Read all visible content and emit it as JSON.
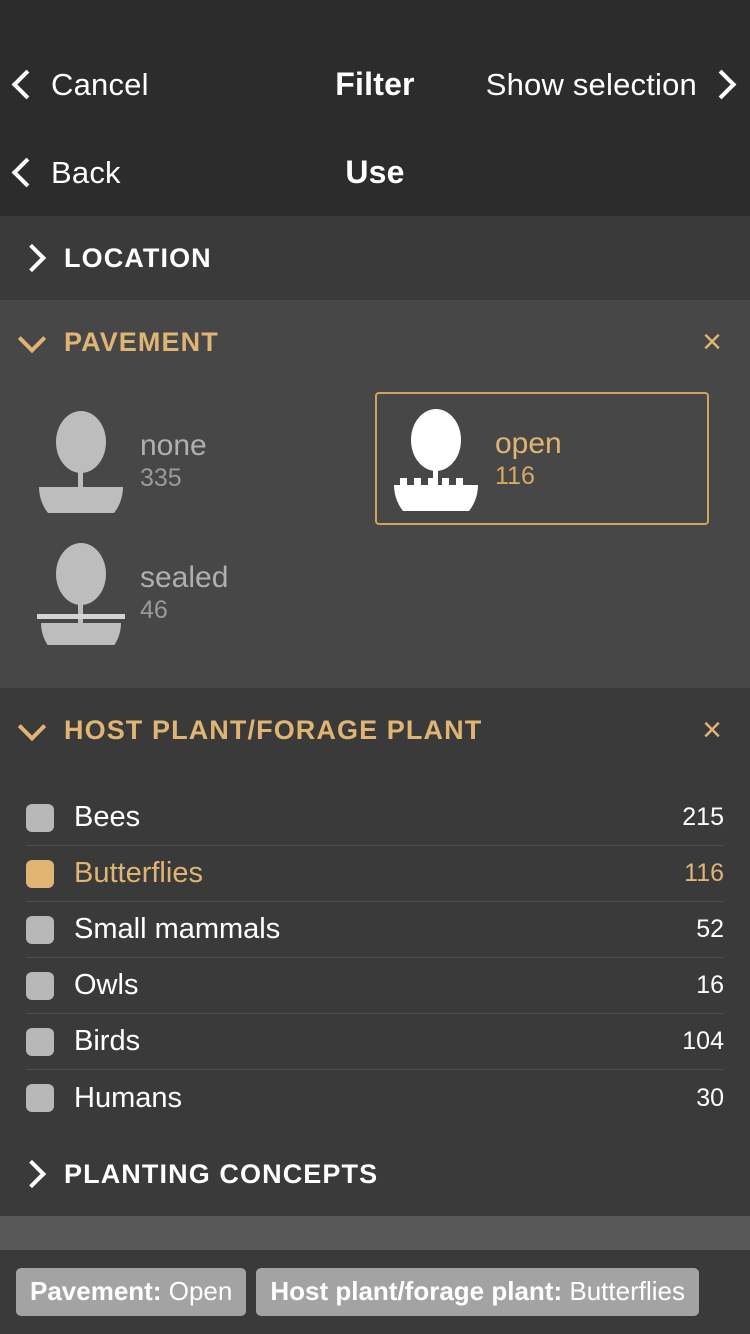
{
  "navbar_primary": {
    "left_label": "Cancel",
    "title": "Filter",
    "right_label": "Show selection",
    "left_icon": "chevron-left-icon",
    "right_icon": "chevron-right-icon"
  },
  "navbar_secondary": {
    "left_label": "Back",
    "title": "Use",
    "left_icon": "chevron-left-icon"
  },
  "sections": {
    "location": {
      "title": "LOCATION",
      "state": "collapsed",
      "arrow_icon": "chevron-right-icon"
    },
    "pavement": {
      "title": "PAVEMENT",
      "state": "expanded",
      "arrow_icon": "chevron-down-icon",
      "close_icon": "close-icon",
      "close_label": "×",
      "options": [
        {
          "name": "none",
          "count": "335",
          "selected": false,
          "icon": "tree-plain-base-icon"
        },
        {
          "name": "open",
          "count": "116",
          "selected": true,
          "icon": "tree-grated-base-icon"
        },
        {
          "name": "sealed",
          "count": "46",
          "selected": false,
          "icon": "tree-sealed-base-icon"
        }
      ]
    },
    "host_plant": {
      "title": "HOST PLANT/FORAGE PLANT",
      "state": "expanded",
      "arrow_icon": "chevron-down-icon",
      "close_icon": "close-icon",
      "close_label": "×",
      "items": [
        {
          "label": "Bees",
          "count": "215",
          "checked": false
        },
        {
          "label": "Butterflies",
          "count": "116",
          "checked": true
        },
        {
          "label": "Small mammals",
          "count": "52",
          "checked": false
        },
        {
          "label": "Owls",
          "count": "16",
          "checked": false
        },
        {
          "label": "Birds",
          "count": "104",
          "checked": false
        },
        {
          "label": "Humans",
          "count": "30",
          "checked": false
        }
      ]
    },
    "planting_concepts": {
      "title": "PLANTING CONCEPTS",
      "state": "collapsed",
      "arrow_icon": "chevron-right-icon"
    }
  },
  "chips": [
    {
      "prefix": "Pavement:",
      "value": "Open"
    },
    {
      "prefix": "Host plant/forage plant:",
      "value": "Butterflies"
    }
  ],
  "colors": {
    "accent_gold": "#e0b473",
    "selection_border": "#d4a259",
    "nav_background": "#2c2c2c",
    "section_collapsed": "#3a3a3a",
    "section_expanded": "#474747",
    "empty_panel": "#585858",
    "checkbox_off": "#b8b8b8",
    "chip_background": "#a3a3a3"
  }
}
